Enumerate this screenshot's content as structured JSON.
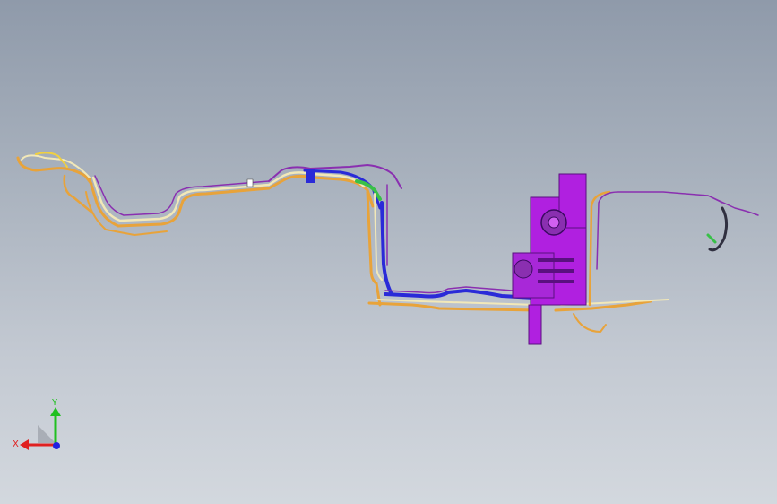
{
  "triad": {
    "x_label": "X",
    "y_label": "Y",
    "x_color": "#e02020",
    "y_color": "#20c020",
    "z_color": "#2020e0"
  },
  "model": {
    "colors": {
      "orange": "#e8a33a",
      "cream": "#f2e8b8",
      "purple": "#8a2fb0",
      "magenta": "#b020e0",
      "blue": "#2a2ad8",
      "green": "#38c048",
      "dark": "#303040"
    }
  }
}
